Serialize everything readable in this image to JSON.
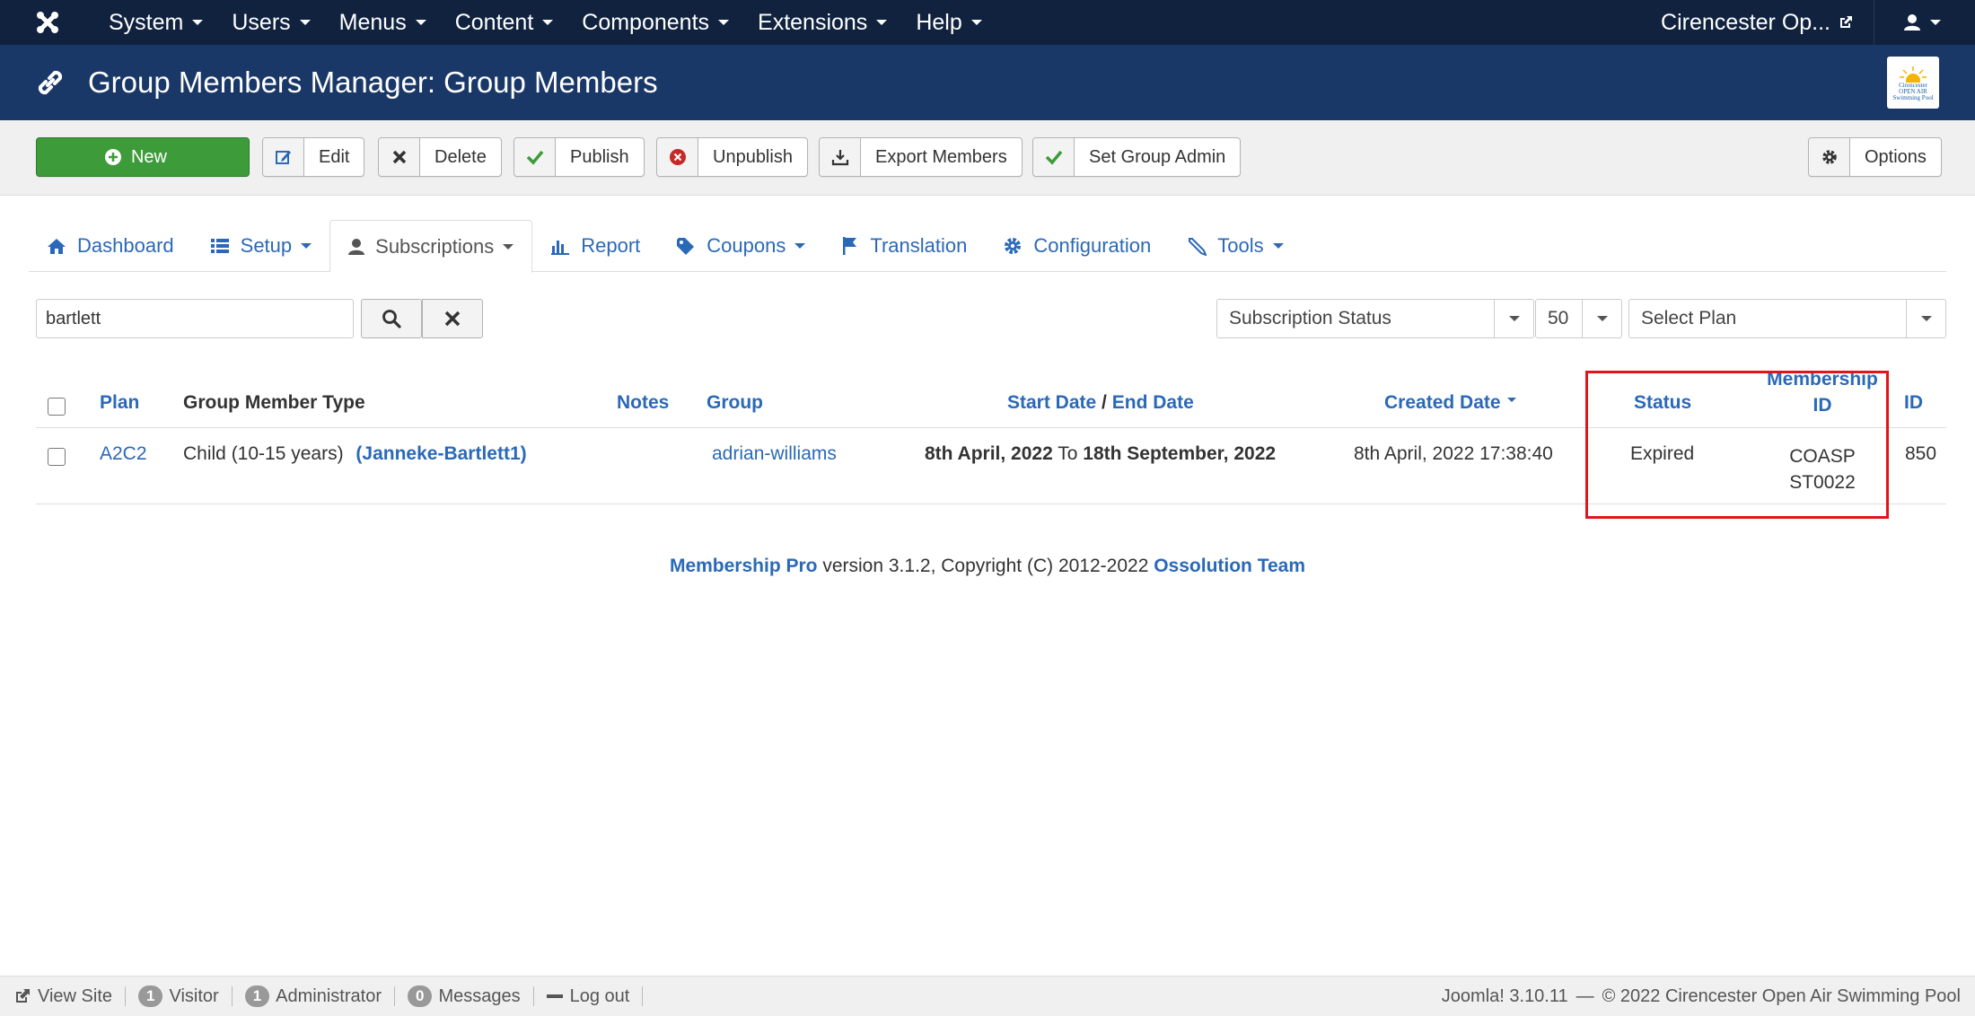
{
  "topnav": {
    "items": [
      "System",
      "Users",
      "Menus",
      "Content",
      "Components",
      "Extensions",
      "Help"
    ],
    "site_label": "Cirencester Op..."
  },
  "header": {
    "title": "Group Members Manager: Group Members",
    "logo_text": [
      "Cirencester",
      "OPEN AIR",
      "Swimming Pool"
    ]
  },
  "toolbar": {
    "new": "New",
    "edit": "Edit",
    "delete": "Delete",
    "publish": "Publish",
    "unpublish": "Unpublish",
    "export": "Export Members",
    "set_admin": "Set Group Admin",
    "options": "Options"
  },
  "tabs": [
    "Dashboard",
    "Setup",
    "Subscriptions",
    "Report",
    "Coupons",
    "Translation",
    "Configuration",
    "Tools"
  ],
  "filters": {
    "search_value": "bartlett",
    "status_select": "Subscription Status",
    "limit_select": "50",
    "plan_select": "Select Plan"
  },
  "table": {
    "headers": {
      "plan": "Plan",
      "type": "Group Member Type",
      "notes": "Notes",
      "group": "Group",
      "start_date": "Start Date",
      "date_sep": "/",
      "end_date": "End Date",
      "created": "Created Date",
      "status": "Status",
      "membership_id_1": "Membership",
      "membership_id_2": "ID",
      "id": "ID"
    },
    "rows": [
      {
        "plan": "A2C2",
        "type": "Child (10-15 years)",
        "member": "(Janneke-Bartlett1)",
        "group": "adrian-williams",
        "start": "8th April, 2022",
        "to": "To",
        "end": "18th September, 2022",
        "created": "8th April, 2022 17:38:40",
        "status": "Expired",
        "membership_id_1": "COASP",
        "membership_id_2": "ST0022",
        "id": "850"
      }
    ]
  },
  "footer": {
    "product": "Membership Pro",
    "text": "version 3.1.2, Copyright (C) 2012-2022",
    "team": "Ossolution Team"
  },
  "statusbar": {
    "view_site": "View Site",
    "visitor_count": "1",
    "visitor": "Visitor",
    "admin_count": "1",
    "admin": "Administrator",
    "messages_count": "0",
    "messages": "Messages",
    "logout": "Log out",
    "version": "Joomla! 3.10.11",
    "dash": "—",
    "copyright": "© 2022 Cirencester Open Air Swimming Pool"
  },
  "colors": {
    "navbar": "#10223e",
    "header": "#1a3867",
    "link": "#2a69b8",
    "new_button": "#3d9b3a",
    "highlight": "#e0151b"
  }
}
